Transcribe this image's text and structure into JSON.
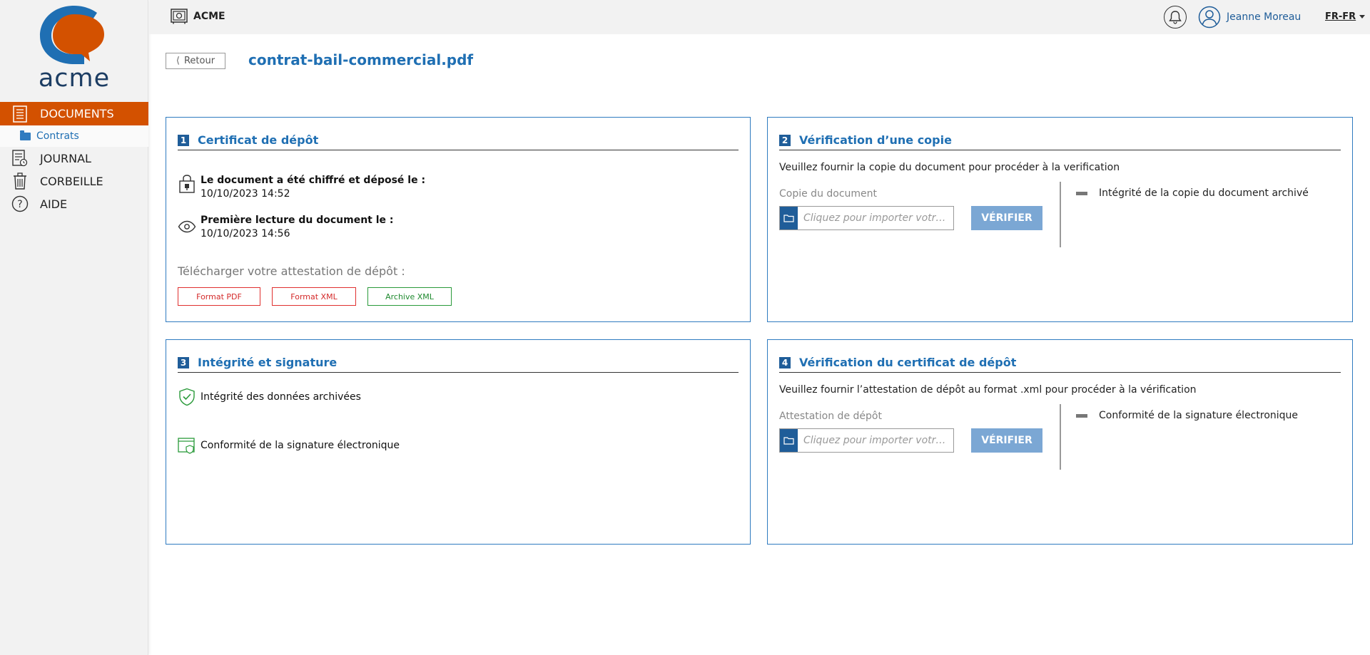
{
  "app": {
    "logo_text": "acme",
    "brand": "ACME",
    "user_name": "Jeanne Moreau",
    "language": "FR-FR"
  },
  "sidebar": {
    "items": [
      {
        "label": "DOCUMENTS",
        "icon": "document-list-icon",
        "active": true
      },
      {
        "label": "JOURNAL",
        "icon": "journal-icon",
        "active": false
      },
      {
        "label": "CORBEILLE",
        "icon": "trash-icon",
        "active": false
      },
      {
        "label": "AIDE",
        "icon": "help-icon",
        "active": false
      }
    ],
    "sub_item": {
      "label": "Contrats",
      "icon": "folder-icon"
    }
  },
  "header": {
    "back_label": "Retour",
    "document_title": "contrat-bail-commercial.pdf"
  },
  "card1": {
    "number": "1",
    "title": "Certificat de dépôt",
    "deposit_label": "Le document a été chiffré et déposé le :",
    "deposit_date": "10/10/2023 14:52",
    "read_label": "Première lecture du document le :",
    "read_date": "10/10/2023 14:56",
    "download_label": "Télécharger votre attestation de dépôt :",
    "buttons": [
      "Format PDF",
      "Format XML",
      "Archive XML"
    ]
  },
  "card2": {
    "number": "2",
    "title": "Vérification d’une copie",
    "instruction": "Veuillez fournir la copie du document pour procéder à la verification",
    "field_label": "Copie du document",
    "placeholder": "Cliquez pour importer votre fichier",
    "verify_label": "VÉRIFIER",
    "status": "Intégrité de la copie du document archivé"
  },
  "card3": {
    "number": "3",
    "title": "Intégrité et signature",
    "integrity": "Intégrité des données archivées",
    "signature": "Conformité de la signature électronique"
  },
  "card4": {
    "number": "4",
    "title": "Vérification du certificat de dépôt",
    "instruction": "Veuillez fournir l’attestation de dépôt au format .xml pour procéder à la vérification",
    "field_label": "Attestation de dépôt",
    "placeholder": "Cliquez pour importer votre fichier",
    "verify_label": "VÉRIFIER",
    "status": "Conformité de la signature électronique"
  },
  "colors": {
    "accent_orange": "#d35100",
    "primary_blue": "#1f6fb3",
    "dark_blue": "#1f5d99",
    "button_blue": "#7ba7d4",
    "red": "#d42a2a",
    "green": "#1f8a2f"
  }
}
